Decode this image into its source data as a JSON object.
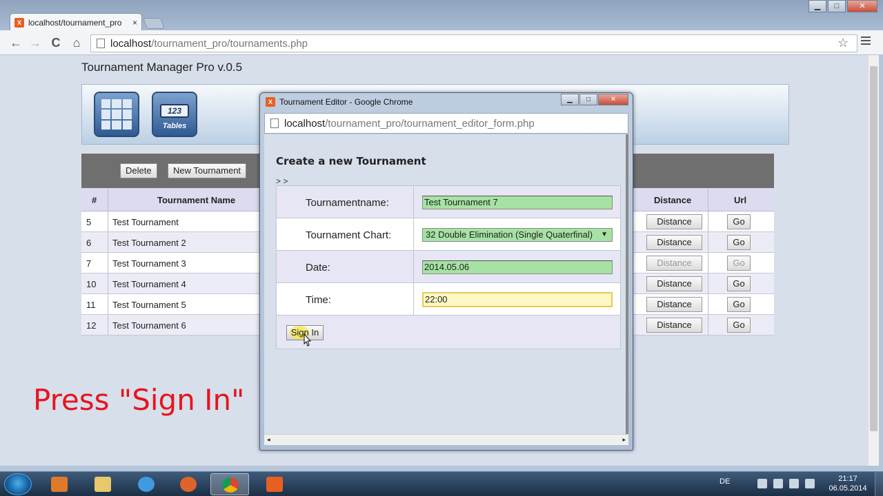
{
  "browser": {
    "tab_title": "localhost/tournament_pro",
    "tab_close": "×",
    "url_host": "localhost",
    "url_path": "/tournament_pro/tournaments.php",
    "back": "←",
    "forward": "→",
    "reload": "C",
    "home": "⌂",
    "star": "☆"
  },
  "window_controls": {
    "minimize": "▁",
    "maximize": "□",
    "close": "✕"
  },
  "app": {
    "title": "Tournament Manager Pro v.0.5",
    "tables_icon_number": "123",
    "tables_icon_label": "Tables"
  },
  "toolbar": {
    "delete": "Delete",
    "new_tournament": "New Tournament"
  },
  "table": {
    "headers": {
      "num": "#",
      "name": "Tournament Name",
      "distance": "Distance",
      "url": "Url"
    },
    "distance_label": "Distance",
    "go_label": "Go",
    "rows": [
      {
        "num": "5",
        "name": "Test Tournament",
        "disabled": false
      },
      {
        "num": "6",
        "name": "Test Tournament 2",
        "disabled": false
      },
      {
        "num": "7",
        "name": "Test Tournament 3",
        "disabled": true
      },
      {
        "num": "10",
        "name": "Test Tournament 4",
        "disabled": false
      },
      {
        "num": "11",
        "name": "Test Tournament 5",
        "disabled": false
      },
      {
        "num": "12",
        "name": "Test Tournament 6",
        "disabled": false
      }
    ]
  },
  "annotation": "Press \"Sign In\"",
  "popup": {
    "title": "Tournament Editor - Google Chrome",
    "url_host": "localhost",
    "url_path": "/tournament_pro/tournament_editor_form.php",
    "form_title": "Create a new Tournament",
    "breadcrumb": "> >",
    "fields": {
      "name_label": "Tournamentname:",
      "name_value": "Test Tournament 7",
      "chart_label": "Tournament Chart:",
      "chart_value": "32 Double Elimination (Single Quaterfinal)",
      "date_label": "Date:",
      "date_value": "2014.05.06",
      "time_label": "Time:",
      "time_value": "22:00"
    },
    "sign_in": "Sign In",
    "scroll_left": "◂",
    "scroll_right": "▸"
  },
  "taskbar": {
    "language": "DE",
    "time": "21:17",
    "date": "06.05.2014"
  }
}
